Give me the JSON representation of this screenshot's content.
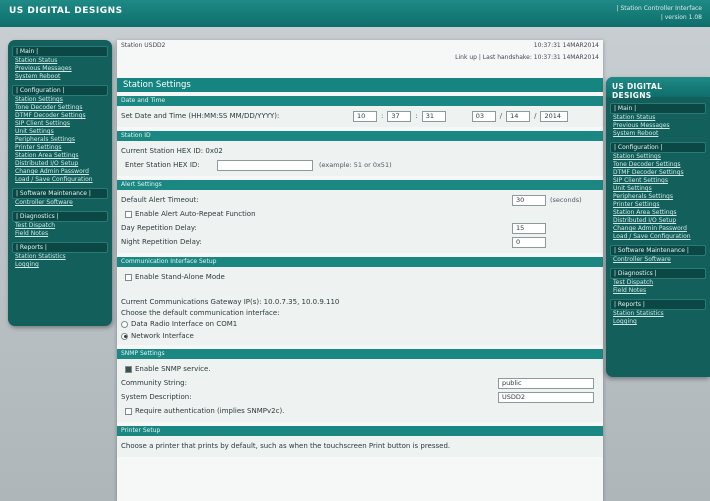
{
  "header": {
    "brand": "US DIGITAL DESIGNS",
    "app_title": "| Station Controller Interface",
    "version": "| version 1.08"
  },
  "status": {
    "station": "Station USDD2",
    "time": "10:37:31 14MAR2014",
    "link": "Link up | Last handshake: 10:37:31 14MAR2014"
  },
  "nav": {
    "main_head": "| Main |",
    "main_items": [
      "Station Status",
      "Previous Messages",
      "System Reboot"
    ],
    "config_head": "| Configuration |",
    "config_items": [
      "Station Settings",
      "Tone Decoder Settings",
      "DTMF Decoder Settings",
      "SIP Client Settings",
      "Unit Settings",
      "Peripherals Settings",
      "Printer Settings",
      "Station Area Settings",
      "Distributed I/O Setup",
      "Change Admin Password",
      "Load / Save Configuration"
    ],
    "maint_head": "| Software Maintenance |",
    "maint_items": [
      "Controller Software"
    ],
    "diag_head": "| Diagnostics |",
    "diag_items": [
      "Test Dispatch",
      "Field Notes"
    ],
    "reports_head": "| Reports |",
    "reports_items": [
      "Station Statistics",
      "Logging"
    ]
  },
  "page": {
    "title": "Station Settings",
    "date_time": {
      "head": "Date and Time",
      "label": "Set Date and Time (HH:MM:SS MM/DD/YYYY):",
      "hh": "10",
      "mm": "37",
      "ss": "31",
      "month": "03",
      "day": "14",
      "year": "2014"
    },
    "station_id": {
      "head": "Station ID",
      "current": "Current Station HEX ID: 0x02",
      "enter_label": "Enter Station HEX ID:",
      "hex_value": "",
      "example": "(example: 51 or 0x51)"
    },
    "alert": {
      "head": "Alert Settings",
      "timeout_label": "Default Alert Timeout:",
      "timeout_value": "30",
      "timeout_unit": "(seconds)",
      "autorepeat_label": "Enable Alert Auto-Repeat Function",
      "day_label": "Day Repetition Delay:",
      "day_value": "15",
      "night_label": "Night Repetition Delay:",
      "night_value": "0"
    },
    "comm": {
      "head": "Communication Interface Setup",
      "standalone_label": "Enable Stand-Alone Mode",
      "gateways": "Current Communications Gateway IP(s): 10.0.7.35, 10.0.9.110",
      "choose": "Choose the default communication interface:",
      "opt_radio": "Data Radio Interface on COM1",
      "opt_network": "Network Interface"
    },
    "snmp": {
      "head": "SNMP Settings",
      "enable_label": "Enable SNMP service.",
      "community_label": "Community String:",
      "community_value": "public",
      "sysdesc_label": "System Description:",
      "sysdesc_value": "USDD2",
      "auth_label": "Require authentication (implies SNMPv2c)."
    },
    "printer": {
      "head": "Printer Setup",
      "desc": "Choose a printer that prints by default, such as when the touchscreen Print button is pressed."
    }
  },
  "colors": {
    "accent": "#168581",
    "sidebar": "#125f5c"
  }
}
